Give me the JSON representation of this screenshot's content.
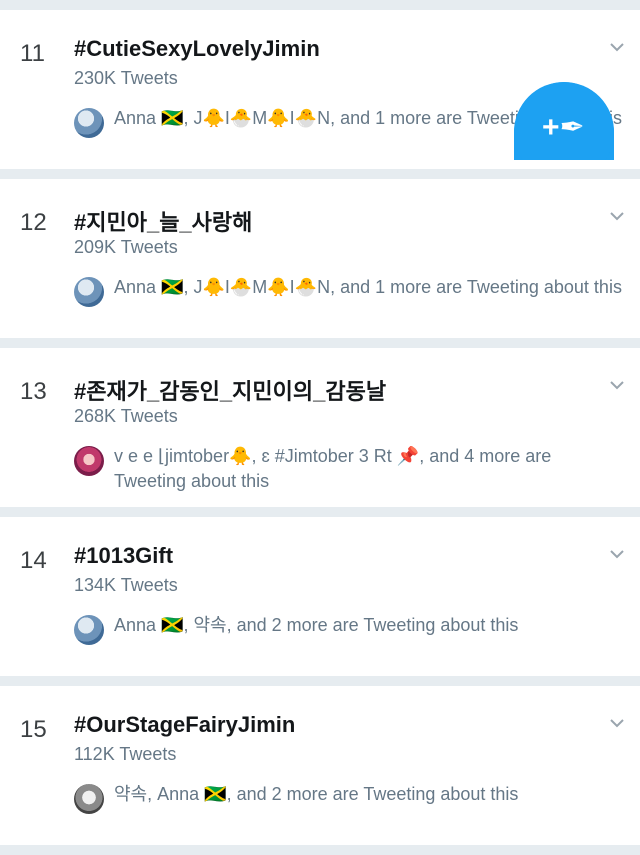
{
  "trends": [
    {
      "rank": "11",
      "hashtag": "#CutieSexyLovelyJimin",
      "count": "230K Tweets",
      "social": "Anna 🇯🇲, J🐥I🐣M🐥I🐣N, and 1 more are Tweeting about this",
      "avatar": "avatar-anna"
    },
    {
      "rank": "12",
      "hashtag": "#지민아_늘_사랑해",
      "count": "209K Tweets",
      "social": "Anna 🇯🇲, J🐥I🐣M🐥I🐣N, and 1 more are Tweeting about this",
      "avatar": "avatar-anna"
    },
    {
      "rank": "13",
      "hashtag": "#존재가_감동인_지민이의_감동날",
      "count": "268K Tweets",
      "social": "v e e ⌊jimtober🐥, ɛ #Jimtober 3 Rt 📌, and 4 more are Tweeting about this",
      "avatar": "avatar-vee"
    },
    {
      "rank": "14",
      "hashtag": "#1013Gift",
      "count": "134K Tweets",
      "social": "Anna 🇯🇲, 약속, and 2 more are Tweeting about this",
      "avatar": "avatar-anna"
    },
    {
      "rank": "15",
      "hashtag": "#OurStageFairyJimin",
      "count": "112K Tweets",
      "social": "약속, Anna 🇯🇲, and 2 more are Tweeting about this",
      "avatar": "avatar-yak"
    }
  ],
  "fab": {
    "icon": "compose-tweet-icon",
    "color": "#1da1f2",
    "glyph": "+✒"
  }
}
